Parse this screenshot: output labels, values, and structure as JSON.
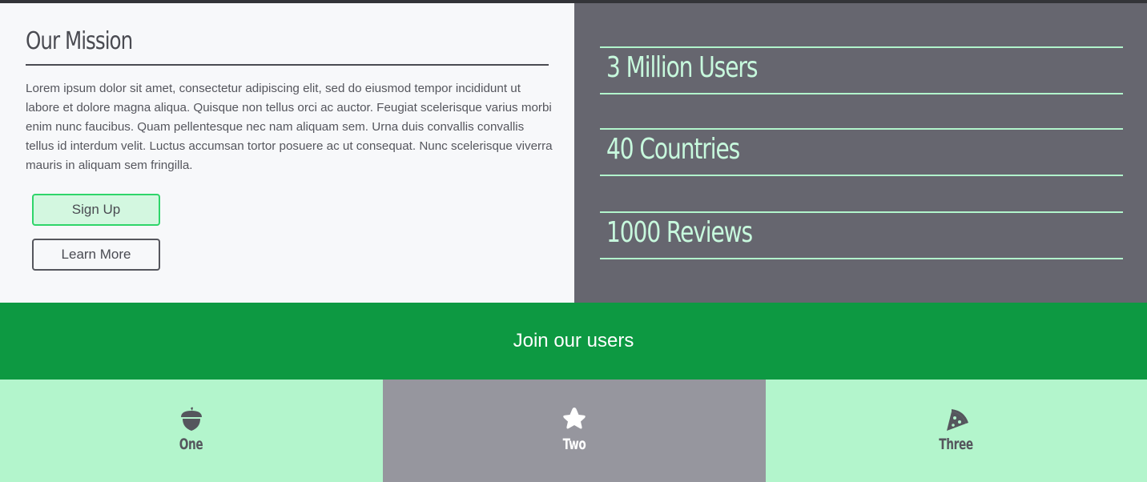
{
  "mission": {
    "title": "Our Mission",
    "body": "Lorem ipsum dolor sit amet, consectetur adipiscing elit, sed do eiusmod tempor incididunt ut labore et dolore magna aliqua. Quisque non tellus orci ac auctor. Feugiat scelerisque varius morbi enim nunc faucibus. Quam pellentesque nec nam aliquam sem. Urna duis convallis convallis tellus id interdum velit. Luctus accumsan tortor posuere ac ut consequat. Nunc scelerisque viverra mauris in aliquam sem fringilla.",
    "signup_label": "Sign Up",
    "learn_more_label": "Learn More"
  },
  "stats": [
    {
      "text": "3 Million Users"
    },
    {
      "text": "40 Countries"
    },
    {
      "text": "1000 Reviews"
    }
  ],
  "join": {
    "text": "Join our users"
  },
  "features": [
    {
      "label": "One",
      "icon": "acorn-icon"
    },
    {
      "label": "Two",
      "icon": "star-icon"
    },
    {
      "label": "Three",
      "icon": "pizza-slice-icon"
    }
  ],
  "colors": {
    "accent_green": "#0d9942",
    "mint": "#b3f5cc",
    "slate": "#66666f",
    "signup_border": "#2fd56a"
  }
}
